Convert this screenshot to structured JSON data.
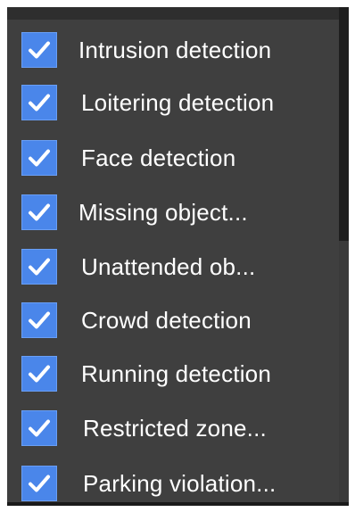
{
  "detection_list": {
    "items": [
      {
        "label": "Intrusion detection",
        "checked": true
      },
      {
        "label": "Loitering detection",
        "checked": true
      },
      {
        "label": "Face detection",
        "checked": true
      },
      {
        "label": "Missing object...",
        "checked": true
      },
      {
        "label": "Unattended ob...",
        "checked": true
      },
      {
        "label": "Crowd detection",
        "checked": true
      },
      {
        "label": "Running detection",
        "checked": true
      },
      {
        "label": "Restricted zone...",
        "checked": true
      },
      {
        "label": "Parking violation...",
        "checked": true
      }
    ]
  },
  "icons": {
    "checkbox": "check-icon"
  },
  "colors": {
    "panel_background": "#3f3f3f",
    "checkbox_fill": "#4a86ea",
    "check_mark": "#ffffff",
    "label_text": "#ffffff"
  }
}
